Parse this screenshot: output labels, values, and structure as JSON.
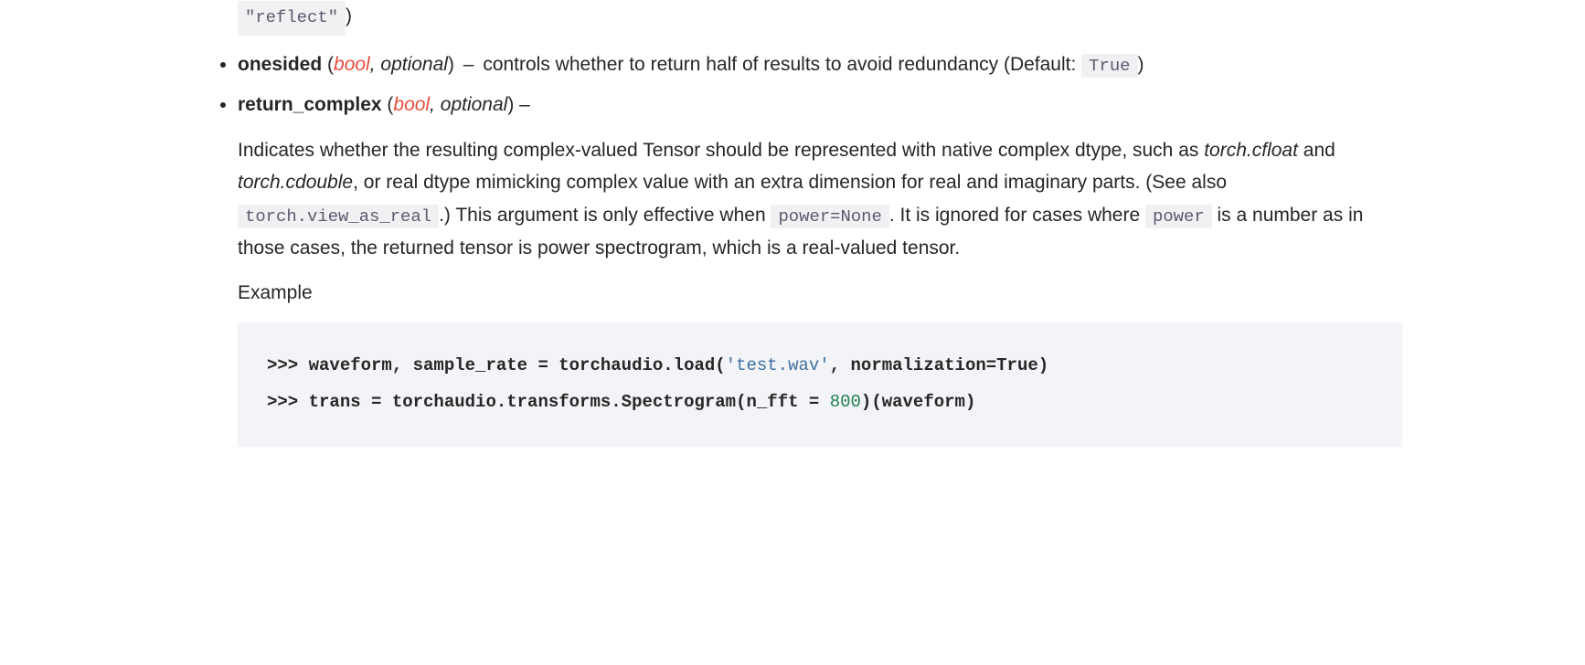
{
  "residual": {
    "reflect": "\"reflect\"",
    "close_paren": ")"
  },
  "params": {
    "onesided": {
      "name": "onesided",
      "type": "bool",
      "optional": ", optional",
      "desc_pre": "controls whether to return half of results to avoid redundancy (Default: ",
      "default_code": "True",
      "desc_post": ")"
    },
    "return_complex": {
      "name": "return_complex",
      "type": "bool",
      "optional": ", optional",
      "dash": " –",
      "desc_1a": "Indicates whether the resulting complex-valued Tensor should be represented with native complex dtype, such as ",
      "em1": "torch.cfloat",
      "desc_1b": " and ",
      "em2": "torch.cdouble",
      "desc_1c": ", or real dtype mimicking complex value with an extra dimension for real and imaginary parts. (See also ",
      "code1": "torch.view_as_real",
      "desc_1d": ".) This argument is only effective when ",
      "code2": "power=None",
      "desc_1e": ". It is ignored for cases where ",
      "code3": "power",
      "desc_1f": " is a number as in those cases, the returned tensor is power spectrogram, which is a real-valued tensor.",
      "example_label": "Example"
    }
  },
  "code": {
    "l1_prompt": ">>> ",
    "l1_a": "waveform, sample_rate = torchaudio.load(",
    "l1_str": "'test.wav'",
    "l1_b": ", normalization=True)",
    "l2_prompt": ">>> ",
    "l2_a": "trans = torchaudio.transforms.Spectrogram(n_fft = ",
    "l2_num": "800",
    "l2_b": ")(waveform)"
  }
}
